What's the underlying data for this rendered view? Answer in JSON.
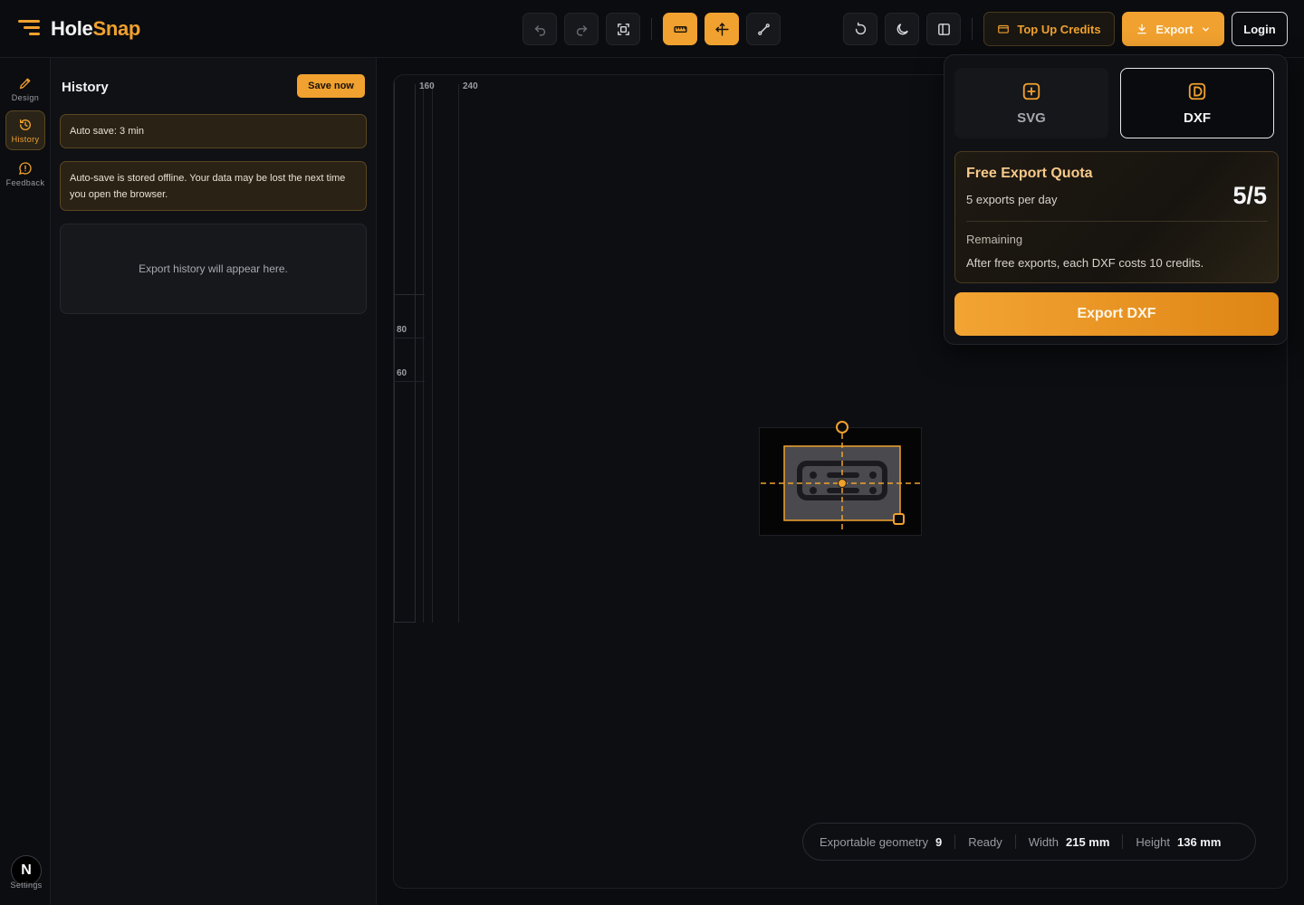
{
  "app": {
    "name_part1": "Hole",
    "name_part2": "Snap"
  },
  "header": {
    "top_up_label": "Top Up Credits",
    "export_label": "Export",
    "login_label": "Login"
  },
  "rail": {
    "design": "Design",
    "history": "History",
    "feedback": "Feedback",
    "settings": "Settings",
    "avatar_letter": "N"
  },
  "history_panel": {
    "title": "History",
    "save_now": "Save now",
    "autosave": "Auto save: 3 min",
    "offline_note": "Auto-save is stored offline. Your data may be lost the next time you open the browser.",
    "empty": "Export history will appear here."
  },
  "canvas": {
    "ruler_top": [
      "160",
      "240"
    ],
    "ruler_left": [
      "80",
      "60"
    ]
  },
  "status": {
    "geometry_label": "Exportable geometry",
    "geometry_value": "9",
    "state": "Ready",
    "width_label": "Width",
    "width_value": "215 mm",
    "height_label": "Height",
    "height_value": "136 mm"
  },
  "export_popover": {
    "formats": [
      {
        "label": "SVG",
        "selected": false
      },
      {
        "label": "DXF",
        "selected": true
      }
    ],
    "quota_title": "Free Export Quota",
    "quota_sub": "5 exports per day",
    "quota_count": "5/5",
    "remaining_label": "Remaining",
    "credit_note": "After free exports, each DXF costs 10 credits.",
    "export_button": "Export DXF"
  },
  "colors": {
    "accent": "#f0a12f",
    "background": "#0b0c0f",
    "panel": "#101115"
  }
}
